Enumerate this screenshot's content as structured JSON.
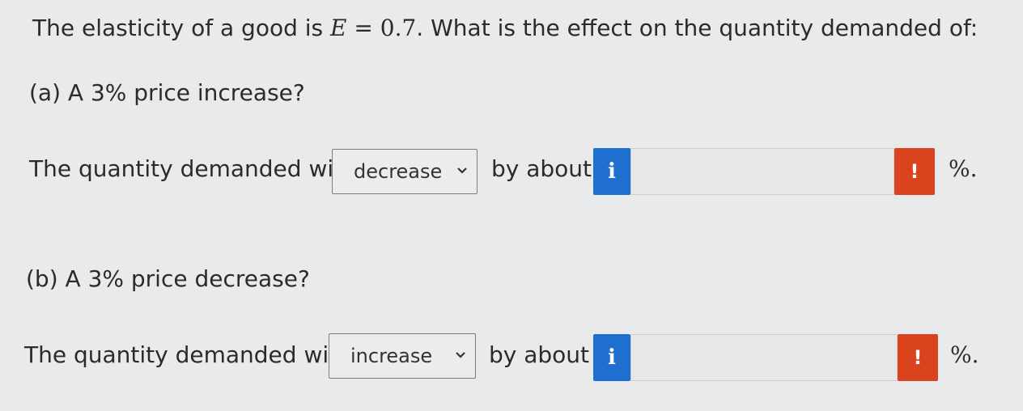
{
  "question": {
    "prefix": "The elasticity of a good is ",
    "var": "E",
    "equals": " = ",
    "value": "0.7",
    "suffix": ". What is the effect on the quantity demanded of:"
  },
  "parts": [
    {
      "label": "(a) A 3% price increase?",
      "sentence_start": "The quantity demanded will",
      "selected_direction": "decrease",
      "by_about": "by about",
      "input_value": "",
      "unit": "%."
    },
    {
      "label": "(b) A 3% price decrease?",
      "sentence_start": "The quantity demanded will",
      "selected_direction": "increase",
      "by_about": "by about",
      "input_value": "",
      "unit": "%."
    }
  ],
  "icons": {
    "info": "i",
    "warning": "!"
  },
  "colors": {
    "info_button": "#1f6fd1",
    "warning_button": "#d9431e",
    "background": "#e9eaeb"
  }
}
